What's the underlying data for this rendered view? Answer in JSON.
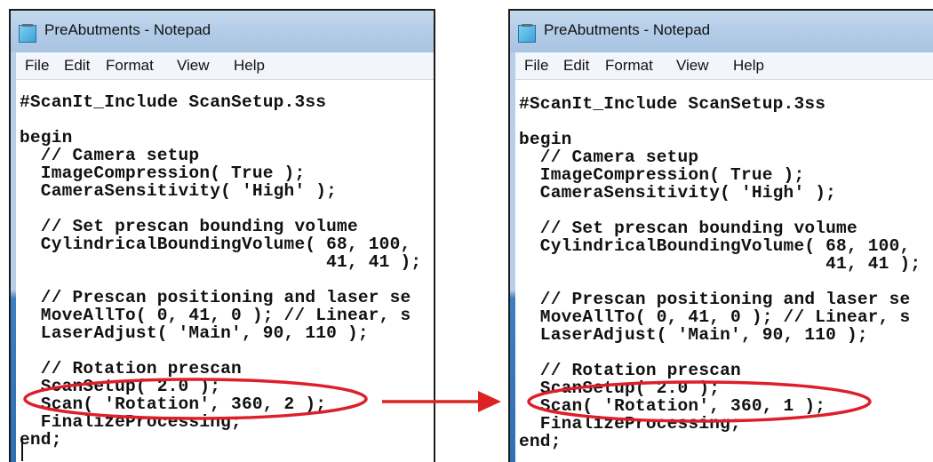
{
  "colors": {
    "highlight": "#dd1f2a",
    "arrow": "#dd2222",
    "titlebar": "#b4cde8"
  },
  "windows": [
    {
      "title": "PreAbutments - Notepad",
      "menu": [
        "File",
        "Edit",
        "Format",
        "View",
        "Help"
      ],
      "lines": [
        "#ScanIt_Include ScanSetup.3ss",
        "",
        "begin",
        "  // Camera setup",
        "  ImageCompression( True );",
        "  CameraSensitivity( 'High' );",
        "",
        "  // Set prescan bounding volume",
        "  CylindricalBoundingVolume( 68, 100,",
        "                             41, 41 );",
        "",
        "  // Prescan positioning and laser se",
        "  MoveAllTo( 0, 41, 0 ); // Linear, s",
        "  LaserAdjust( 'Main', 90, 110 );",
        "",
        "  // Rotation prescan",
        "  ScanSetup( 2.0 );",
        "  Scan( 'Rotation', 360, 2 );",
        "  FinalizeProcessing;",
        "end;"
      ]
    },
    {
      "title": "PreAbutments - Notepad",
      "menu": [
        "File",
        "Edit",
        "Format",
        "View",
        "Help"
      ],
      "lines": [
        "#ScanIt_Include ScanSetup.3ss",
        "",
        "begin",
        "  // Camera setup",
        "  ImageCompression( True );",
        "  CameraSensitivity( 'High' );",
        "",
        "  // Set prescan bounding volume",
        "  CylindricalBoundingVolume( 68, 100,",
        "                             41, 41 );",
        "",
        "  // Prescan positioning and laser se",
        "  MoveAllTo( 0, 41, 0 ); // Linear, s",
        "  LaserAdjust( 'Main', 90, 110 );",
        "",
        "  // Rotation prescan",
        "  ScanSetup( 2.0 );",
        "  Scan( 'Rotation', 360, 1 );",
        "  FinalizeProcessing;",
        "end;"
      ]
    }
  ]
}
